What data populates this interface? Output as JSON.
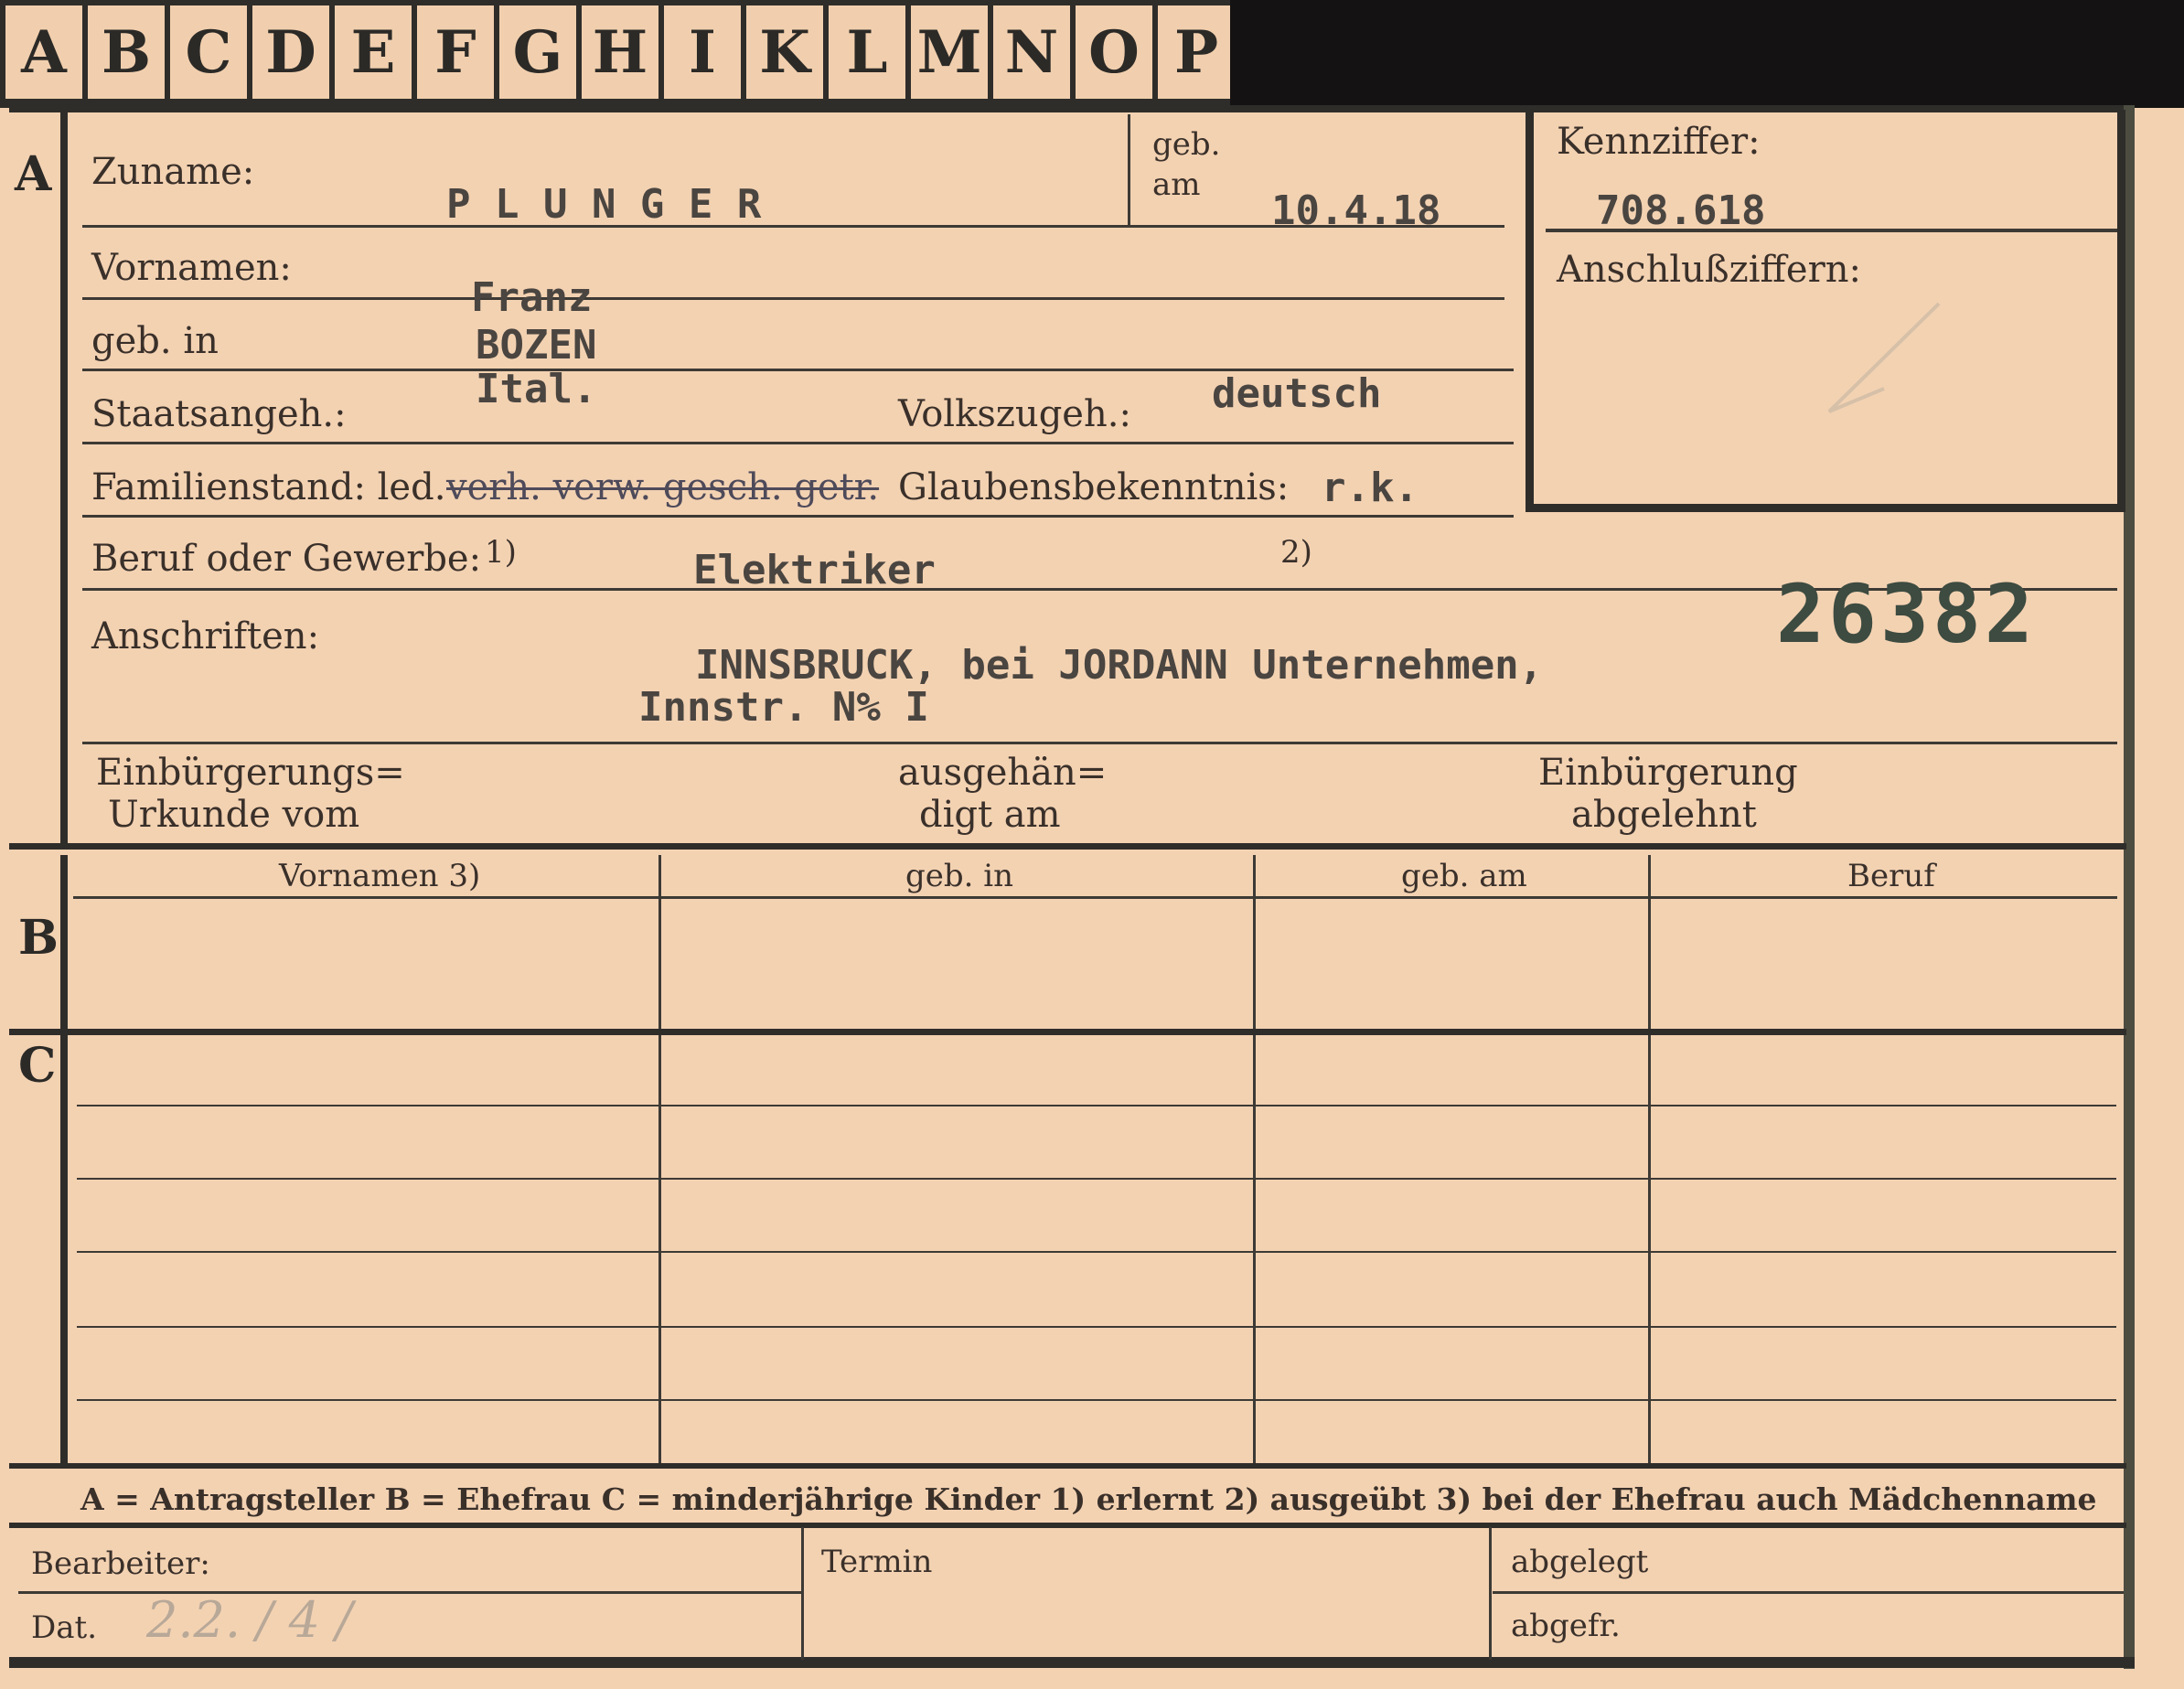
{
  "tabs": [
    "A",
    "B",
    "C",
    "D",
    "E",
    "F",
    "G",
    "H",
    "I",
    "K",
    "L",
    "M",
    "N",
    "O",
    "P"
  ],
  "sections": {
    "a": "A",
    "b": "B",
    "c": "C"
  },
  "fields": {
    "zuname_label": "Zuname:",
    "zuname_value": "P L U N G E R",
    "geb_label_1": "geb.",
    "geb_label_2": "am",
    "geb_am_value": "10.4.18",
    "kennziffer_label": "Kennziffer:",
    "kennziffer_value": "708.618",
    "anschluss_label": "Anschlußziffern:",
    "vornamen_label": "Vornamen:",
    "vornamen_value": "Franz",
    "geb_in_label": "geb. in",
    "geb_in_value": "BOZEN",
    "staatsangeh_label": "Staatsangeh.:",
    "staatsangeh_value": "Ital.",
    "volkszugeh_label": "Volkszugeh.:",
    "volkszugeh_value": "deutsch",
    "familienstand_label": "Familienstand: led.",
    "familienstand_options": "verh. verw. gesch. getr.",
    "glaubens_label": "Glaubensbekenntnis:",
    "glaubens_value": "r.k.",
    "beruf_label": "Beruf oder Gewerbe:",
    "beruf_note1": "1)",
    "beruf_value": "Elektriker",
    "beruf_note2": "2)",
    "stamp_number": "26382",
    "anschriften_label": "Anschriften:",
    "anschrift_line1": "INNSBRUCK, bei JORDANN Unternehmen,",
    "anschrift_line2": "Innstr. N% I",
    "einb_urkunde_1": "Einbürgerungs=",
    "einb_urkunde_2": "Urkunde vom",
    "ausgeh_1": "ausgehän=",
    "ausgeh_2": "digt am",
    "einb_abgelehnt_1": "Einbürgerung",
    "einb_abgelehnt_2": "abgelehnt"
  },
  "table_b_headers": [
    "Vornamen 3)",
    "geb. in",
    "geb. am",
    "Beruf"
  ],
  "legend": "A = Antragsteller   B = Ehefrau   C = minderjährige Kinder   1) erlernt   2) ausgeübt   3) bei der Ehefrau auch Mädchenname",
  "footer": {
    "bearbeiter": "Bearbeiter:",
    "dat": "Dat.",
    "dat_value": "2.2.  / 4   /",
    "termin": "Termin",
    "abgelegt": "abgelegt",
    "abgefr": "abgefr."
  }
}
